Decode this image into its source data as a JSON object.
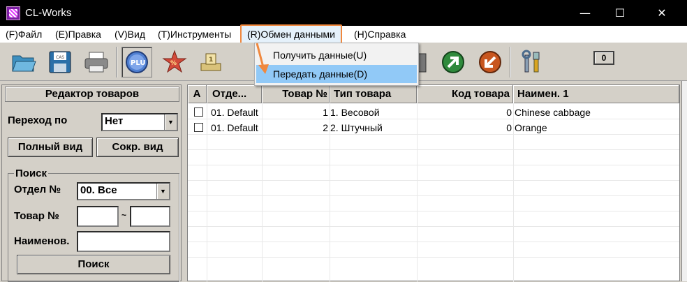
{
  "window": {
    "title": "CL-Works",
    "minimize": "—",
    "maximize": "☐",
    "close": "✕"
  },
  "menu": {
    "file": "(F)Файл",
    "edit": "(E)Правка",
    "view": "(V)Вид",
    "tools": "(T)Инструменты",
    "exchange": "(R)Обмен данными",
    "help": "(H)Справка"
  },
  "dropdown": {
    "receive": "Получить данные(U)",
    "send": "Передать данные(D)"
  },
  "toolbar": {
    "counter": "0",
    "icons": [
      "folder-open-icon",
      "save-disk-icon",
      "printer-icon",
      "plu-icon",
      "discount-star-icon",
      "department-stamp-icon",
      "scale-icon",
      "green-arrow-icon",
      "orange-arrow-icon",
      "settings-tools-icon"
    ]
  },
  "left_panel": {
    "title": "Редактор товаров",
    "goto_label": "Переход по",
    "goto_value": "Нет",
    "full_view": "Полный вид",
    "short_view": "Сокр. вид",
    "search_group": "Поиск",
    "dept_label": "Отдел №",
    "dept_value": "00. Все",
    "item_label": "Товар №",
    "range_sep": "~",
    "name_label": "Наименов.",
    "search_button": "Поиск"
  },
  "table": {
    "columns": [
      "A",
      "Отде...",
      "Товар №",
      "Тип товара",
      "Код товара",
      "Наимен. 1"
    ],
    "rows": [
      {
        "dept": "01. Default",
        "item_no": "1",
        "type": "1. Весовой",
        "code": "0",
        "name": "Chinese cabbage"
      },
      {
        "dept": "01. Default",
        "item_no": "2",
        "type": "2. Штучный",
        "code": "0",
        "name": "Orange"
      }
    ]
  },
  "colors": {
    "highlight_border": "#f0883e",
    "menu_selected": "#91c9f7",
    "title_bar": "#000000"
  }
}
